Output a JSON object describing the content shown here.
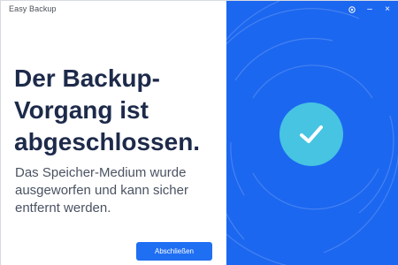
{
  "window": {
    "title": "Easy Backup",
    "controls": {
      "settings_icon": "gear-icon",
      "minimize_label": "–",
      "close_label": "×"
    }
  },
  "main": {
    "headline_lines": [
      "Der Backup-",
      "Vorgang ist",
      "abgeschlossen."
    ],
    "description_lines": [
      "Das Speicher-Medium wurde",
      "ausgeworfen und kann sicher",
      "entfernt werden."
    ],
    "primary_button_label": "Abschließen"
  },
  "status": {
    "icon": "checkmark-icon"
  },
  "colors": {
    "accent": "#1f6ff2",
    "panel": "#1c67f0",
    "success_circle": "#46c4e2",
    "headline": "#1d2a4a"
  }
}
